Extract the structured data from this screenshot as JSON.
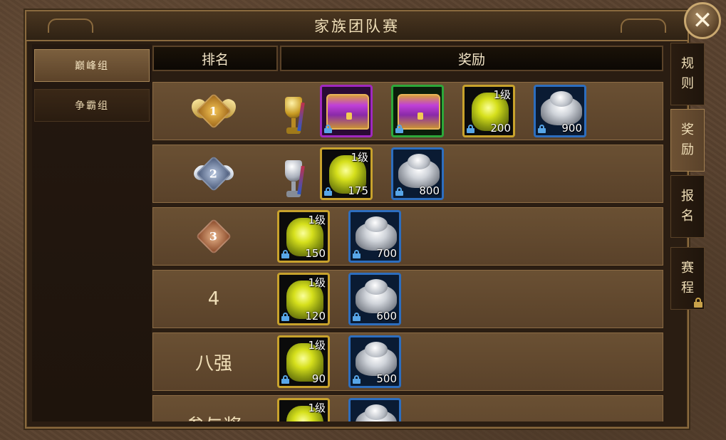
{
  "window": {
    "title": "家族团队赛",
    "close_icon": "close-icon"
  },
  "groups": [
    {
      "label": "巅峰组",
      "active": true
    },
    {
      "label": "争霸组",
      "active": false
    }
  ],
  "table": {
    "headers": {
      "rank": "排名",
      "reward": "奖励"
    },
    "rows": [
      {
        "rank": "1",
        "rank_style": "gold-badge",
        "trophy": "gold-trophy",
        "items": [
          {
            "type": "purple-chest",
            "quality": "purple"
          },
          {
            "type": "purple-chest",
            "quality": "green"
          },
          {
            "type": "yellow-gem",
            "quality": "gold",
            "level": "1级",
            "qty": "200"
          },
          {
            "type": "silver-ingot",
            "quality": "blue",
            "qty": "900"
          }
        ]
      },
      {
        "rank": "2",
        "rank_style": "silver-badge",
        "trophy": "silver-trophy",
        "items": [
          {
            "type": "yellow-gem",
            "quality": "gold",
            "level": "1级",
            "qty": "175"
          },
          {
            "type": "silver-ingot",
            "quality": "blue",
            "qty": "800"
          }
        ]
      },
      {
        "rank": "3",
        "rank_style": "bronze-badge",
        "items": [
          {
            "type": "yellow-gem",
            "quality": "gold",
            "level": "1级",
            "qty": "150"
          },
          {
            "type": "silver-ingot",
            "quality": "blue",
            "qty": "700"
          }
        ]
      },
      {
        "rank": "4",
        "items": [
          {
            "type": "yellow-gem",
            "quality": "gold",
            "level": "1级",
            "qty": "120"
          },
          {
            "type": "silver-ingot",
            "quality": "blue",
            "qty": "600"
          }
        ]
      },
      {
        "rank": "八强",
        "items": [
          {
            "type": "yellow-gem",
            "quality": "gold",
            "level": "1级",
            "qty": "90"
          },
          {
            "type": "silver-ingot",
            "quality": "blue",
            "qty": "500"
          }
        ]
      },
      {
        "rank": "参与奖",
        "items": [
          {
            "type": "yellow-gem",
            "quality": "gold",
            "level": "1级"
          },
          {
            "type": "silver-ingot",
            "quality": "blue"
          }
        ]
      }
    ]
  },
  "side_tabs": [
    {
      "label": [
        "规",
        "则"
      ],
      "active": false
    },
    {
      "label": [
        "奖",
        "励"
      ],
      "active": true
    },
    {
      "label": [
        "报",
        "名"
      ],
      "active": false
    },
    {
      "label": [
        "赛",
        "程"
      ],
      "active": false,
      "locked": true
    }
  ],
  "colors": {
    "frame": "#8a6a3e",
    "row": "#6a5033",
    "gold": "#c8a22c",
    "blue": "#2d6ebf",
    "purple": "#a028c0",
    "green": "#2da83a"
  }
}
